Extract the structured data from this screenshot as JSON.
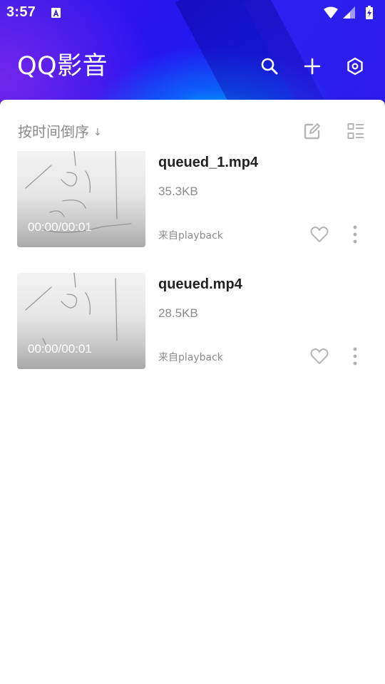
{
  "status_bar": {
    "time": "3:57",
    "icons": [
      "notification-a-icon",
      "wifi-icon",
      "cell-signal-icon",
      "battery-charging-icon"
    ]
  },
  "header": {
    "title": "QQ影音",
    "actions": [
      "search-icon",
      "add-icon",
      "settings-hexagon-icon"
    ]
  },
  "toolbar": {
    "sort_label": "按时间倒序",
    "sort_arrow": "↓",
    "actions": [
      "edit-icon",
      "list-view-icon"
    ]
  },
  "videos": [
    {
      "name": "queued_1.mp4",
      "size": "35.3KB",
      "source": "来自playback",
      "duration": "00:00/00:01",
      "favorited": false
    },
    {
      "name": "queued.mp4",
      "size": "28.5KB",
      "source": "来自playback",
      "duration": "00:00/00:01",
      "favorited": false
    }
  ],
  "colors": {
    "header_primary": "#2a14ee",
    "header_accent": "#00d2ff",
    "title_text": "#222222",
    "secondary_text": "#8c8c8c",
    "icon_grey": "#b5b5b5"
  }
}
